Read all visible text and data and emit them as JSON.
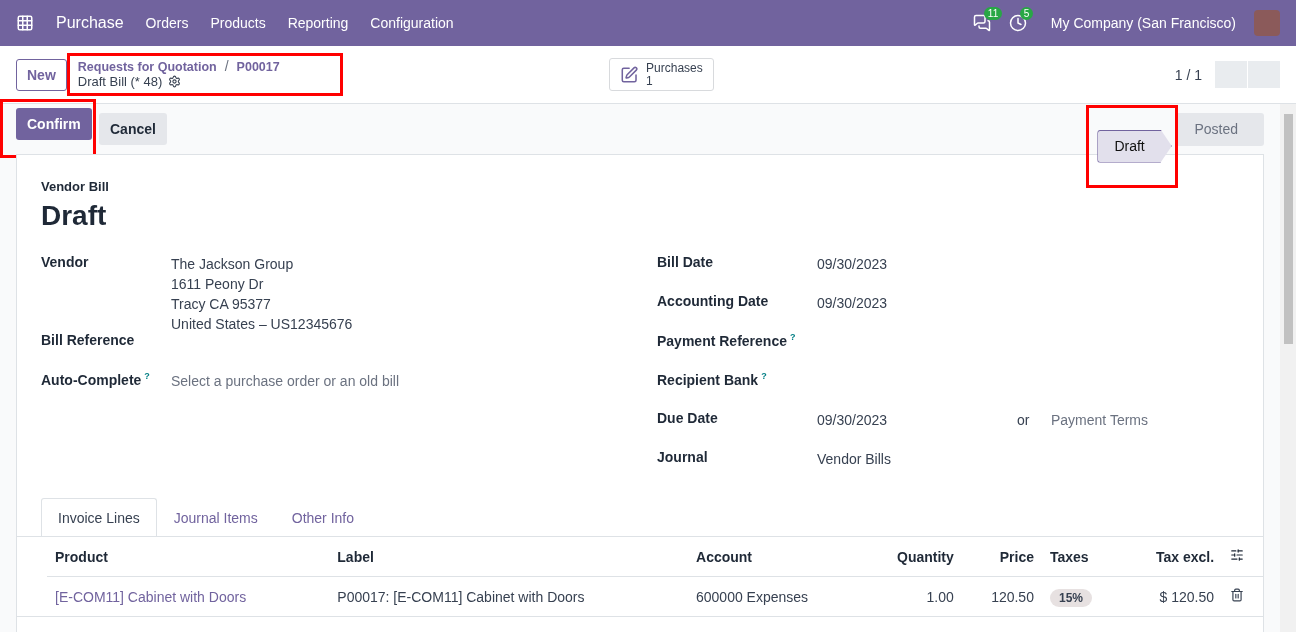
{
  "navbar": {
    "app": "Purchase",
    "menus": [
      "Orders",
      "Products",
      "Reporting",
      "Configuration"
    ],
    "messages_count": "11",
    "activities_count": "5",
    "company": "My Company (San Francisco)"
  },
  "control_panel": {
    "new_button": "New",
    "breadcrumb": {
      "highlighted": true,
      "parent": "Requests for Quotation",
      "separator": "/",
      "record": "P00017",
      "current": "Draft Bill (* 48)"
    },
    "smart_button": {
      "label": "Purchases",
      "count": "1"
    },
    "pager": "1 / 1"
  },
  "actions": {
    "buttons": [
      {
        "label": "Confirm",
        "kind": "primary",
        "highlighted": true
      },
      {
        "label": "Cancel",
        "kind": "secondary",
        "highlighted": false
      }
    ],
    "stages": [
      {
        "label": "Draft",
        "selected": true,
        "highlighted": true
      },
      {
        "label": "Posted",
        "selected": false,
        "highlighted": false
      }
    ]
  },
  "sheet": {
    "type_label": "Vendor Bill",
    "title": "Draft",
    "left_fields": [
      {
        "label": "Vendor",
        "value": "The Jackson Group",
        "lines": [
          "1611 Peony Dr",
          "Tracy CA 95377",
          "United States – US12345676"
        ]
      },
      {
        "label": "Bill Reference"
      },
      {
        "label": "Auto-Complete",
        "help": "?",
        "placeholder": "Select a purchase order or an old bill"
      }
    ],
    "right_fields": [
      {
        "label": "Bill Date",
        "value": "09/30/2023"
      },
      {
        "label": "Accounting Date",
        "value": "09/30/2023"
      },
      {
        "label": "Payment Reference",
        "help": "?"
      },
      {
        "label": "Recipient Bank",
        "help": "?"
      },
      {
        "label": "Due Date",
        "value": "09/30/2023",
        "or": "or",
        "placeholder": "Payment Terms"
      },
      {
        "label": "Journal",
        "value": "Vendor Bills"
      }
    ],
    "tabs": [
      {
        "label": "Invoice Lines",
        "selected": true
      },
      {
        "label": "Journal Items",
        "selected": false
      },
      {
        "label": "Other Info",
        "selected": false
      }
    ],
    "table": {
      "columns": [
        "Product",
        "Label",
        "Account",
        "Quantity",
        "Price",
        "Taxes",
        "Tax excl."
      ],
      "rows": [
        {
          "product": "[E-COM11] Cabinet with Doors",
          "label": "P00017: [E-COM11] Cabinet with Doors",
          "account": "600000 Expenses",
          "quantity": "1.00",
          "price": "120.50",
          "taxes": "15%",
          "tax_excl": "$ 120.50"
        }
      ]
    }
  }
}
